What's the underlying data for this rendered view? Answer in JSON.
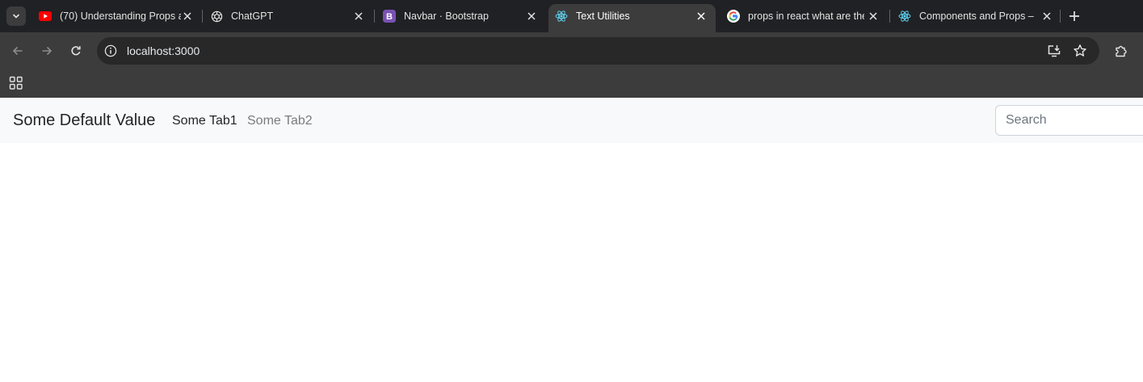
{
  "browser": {
    "tabs": [
      {
        "title": "(70) Understanding Props a",
        "favicon": "youtube-icon"
      },
      {
        "title": "ChatGPT",
        "favicon": "chatgpt-icon"
      },
      {
        "title": "Navbar · Bootstrap",
        "favicon": "bootstrap-icon"
      },
      {
        "title": "Text Utilities",
        "favicon": "react-icon",
        "active": true
      },
      {
        "title": "props in react what are the",
        "favicon": "google-icon"
      },
      {
        "title": "Components and Props – R",
        "favicon": "react-icon"
      }
    ],
    "url": "localhost:3000",
    "colors": {
      "frame": "#202124",
      "toolbar": "#3c3c3c",
      "omnibox": "#282828"
    }
  },
  "page": {
    "navbar": {
      "brand": "Some Default Value",
      "links": [
        "Some Tab1",
        "Some Tab2"
      ],
      "search_placeholder": "Search"
    },
    "colors": {
      "navbar_bg": "#f8f9fa",
      "text": "#212529",
      "muted": "#7a7c80"
    }
  }
}
